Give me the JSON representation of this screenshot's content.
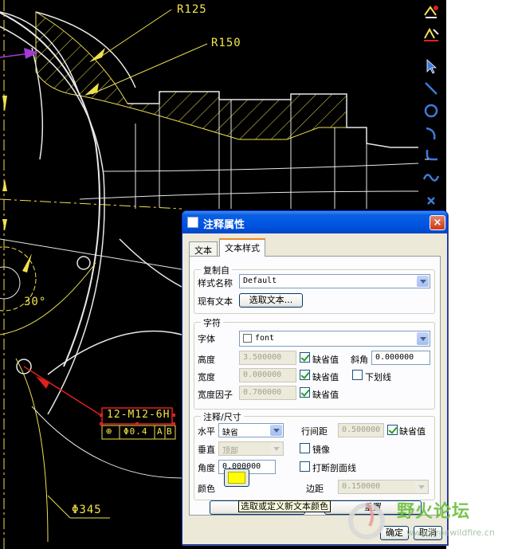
{
  "cad": {
    "radius_labels": [
      "R125",
      "R150"
    ],
    "angle_label": "30°",
    "diameter_label": "Φ345",
    "tolerance_top": "12-M12-6H",
    "tolerance_symbol": "⊕",
    "tolerance_value": "Φ0.4",
    "tolerance_datum_a": "A",
    "tolerance_datum_b": "B"
  },
  "toolbar": {
    "icons": [
      "sketch-text-icon",
      "sketch-dimension-icon",
      "select-arrow-icon",
      "line-icon",
      "circle-icon",
      "arc-icon",
      "fillet-icon",
      "spline-icon",
      "delete-segment-icon"
    ]
  },
  "dialog": {
    "title": "注释属性",
    "close": "×",
    "tabs": [
      {
        "label": "文本",
        "active": false
      },
      {
        "label": "文本样式",
        "active": true
      }
    ],
    "copy_from": {
      "title": "复制自",
      "style_name_label": "样式名称",
      "style_name_value": "Default",
      "existing_text_label": "现有文本",
      "select_text_button": "选取文本..."
    },
    "character": {
      "title": "字符",
      "font_label": "字体",
      "font_value": "font",
      "height_label": "高度",
      "height_value": "3.500000",
      "height_default_checked": true,
      "default_label": "缺省值",
      "slant_label": "斜角",
      "slant_value": "0.000000",
      "width_label": "宽度",
      "width_value": "0.000000",
      "width_default_checked": true,
      "underline_label": "下划线",
      "underline_checked": false,
      "width_factor_label": "宽度因子",
      "width_factor_value": "0.700000",
      "width_factor_default_checked": true
    },
    "note_dim": {
      "title": "注释/尺寸",
      "horizontal_label": "水平",
      "horizontal_value": "缺省",
      "line_spacing_label": "行间距",
      "line_spacing_value": "0.500000",
      "line_spacing_default_checked": true,
      "vertical_label": "垂直",
      "vertical_value": "顶部",
      "mirror_label": "镜像",
      "mirror_checked": false,
      "angle_label": "角度",
      "angle_value": "0.000000",
      "break_hatch_label": "打断剖面线",
      "break_hatch_checked": false,
      "color_label": "颜色",
      "color_value": "#ffff00",
      "margin_label": "边距",
      "margin_value": "0.150000"
    },
    "tooltip": "选取或定义新文本颜色",
    "reset_button": "重置",
    "ok_button": "确定",
    "cancel_button": "取消"
  },
  "watermark": {
    "title": "野火论坛",
    "subtitle": "www.proewildfire.cn"
  }
}
